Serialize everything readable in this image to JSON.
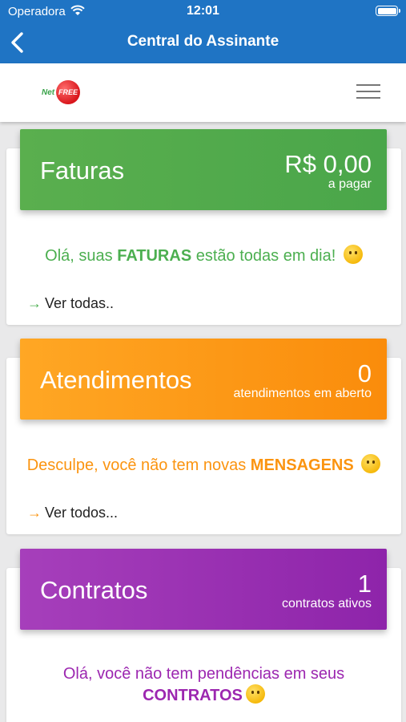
{
  "status_bar": {
    "carrier": "Operadora",
    "time": "12:01"
  },
  "nav": {
    "title": "Central do Assinante"
  },
  "header": {
    "logo_net": "Net",
    "logo_free": "FREE"
  },
  "colors": {
    "primary": "#1f74c4",
    "green": "#4caf50",
    "orange": "#fb9410",
    "purple": "#9c27b0"
  },
  "cards": {
    "faturas": {
      "title": "Faturas",
      "value": "R$ 0,00",
      "sub": "a pagar",
      "msg_pre": "Olá, suas ",
      "msg_bold": "FATURAS",
      "msg_post": " estão todas em dia!",
      "link": "Ver todas.."
    },
    "atendimentos": {
      "title": "Atendimentos",
      "value": "0",
      "sub": "atendimentos em aberto",
      "msg_pre": "Desculpe, você não tem novas ",
      "msg_bold": "MENSAGENS",
      "link": "Ver todos..."
    },
    "contratos": {
      "title": "Contratos",
      "value": "1",
      "sub": "contratos ativos",
      "msg_pre": "Olá, você não tem pendências em seus",
      "msg_bold": "CONTRATOS"
    }
  }
}
